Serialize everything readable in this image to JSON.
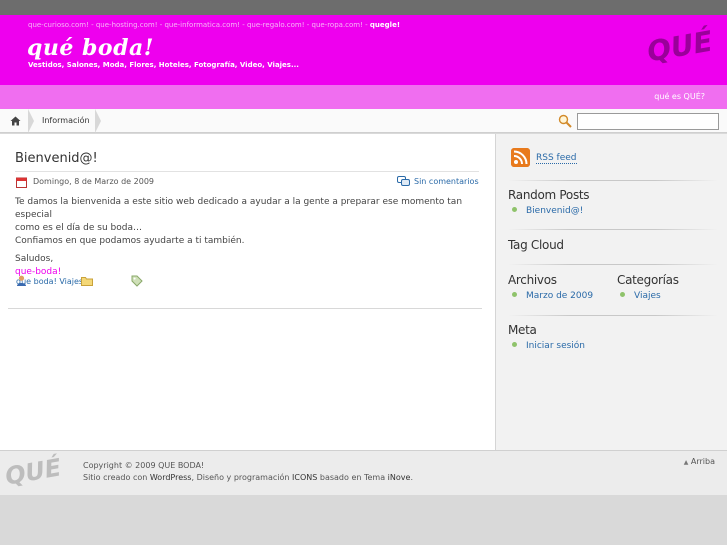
{
  "header": {
    "sites": "que-curioso.com! - que-hosting.com! - que-informatica.com! - que-regalo.com! - que-ropa.com! -",
    "sites_active": "quegle!",
    "title": "qué boda!",
    "tagline": "Vestidos, Salones, Moda, Flores, Hoteles, Fotografía, Video, Viajes...",
    "brand": "QUÉ",
    "about_link": "qué es QUÉ?"
  },
  "navbar": {
    "breadcrumb": "Información",
    "search_value": ""
  },
  "post": {
    "title": "Bienvenid@!",
    "date": "Domingo, 8 de Marzo de 2009",
    "comments": "Sin comentarios",
    "paragraph1_line1": "Te damos la bienvenida a este sitio web dedicado a ayudar a la gente a preparar ese momento tan especial",
    "paragraph1_line2": "como es el día de su boda…",
    "paragraph1_line3": "Confiamos en que podamos ayudarte a ti también.",
    "greeting": "Saludos,",
    "signature": "que-boda!",
    "author": "que boda!",
    "category": "Viajes"
  },
  "sidebar": {
    "rss": "RSS feed",
    "random_posts": {
      "title": "Random Posts",
      "items": [
        "Bienvenid@!"
      ]
    },
    "tag_cloud": {
      "title": "Tag Cloud"
    },
    "archives": {
      "title": "Archivos",
      "items": [
        "Marzo de 2009"
      ]
    },
    "categories": {
      "title": "Categorías",
      "items": [
        "Viajes"
      ]
    },
    "meta": {
      "title": "Meta",
      "items": [
        "Iniciar sesión"
      ]
    }
  },
  "footer": {
    "brand": "QUÉ",
    "copyright": "Copyright © 2009 QUE BODA!",
    "credits_1": "Sitio creado con",
    "credits_wp": "WordPress",
    "credits_2": ", Diseño y programación",
    "credits_icons": "ICONS",
    "credits_3": "basado en Tema",
    "credits_theme": "iNove",
    "credits_end": ".",
    "top": "Arriba"
  },
  "colors": {
    "header": "#ee00ee",
    "subbar": "#f06ef0",
    "link": "#2a6aa8",
    "bullet": "#8fc36b"
  }
}
